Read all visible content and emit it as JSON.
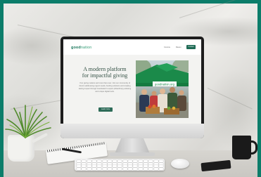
{
  "website": {
    "logo_part1": "good",
    "logo_part2": "nation",
    "nav_links": [
      "Commu",
      "Resou"
    ],
    "nav_button": "Contact",
    "hero_title_line1": "A modern platform",
    "hero_title_line2": "for impactful giving",
    "hero_body": "Your giving matters and more than ever. Join our community of donors addressing urgent needs, funding solutions and creating lasting impact through Goodnation's expert philanthropy advising and unique digital tools.",
    "hero_button": "Learn more",
    "photo_banner_text": "goodnation.org"
  },
  "colors": {
    "frame": "#0c7d6a",
    "brand_green": "#1f7a5f",
    "tent_green": "#1b8a4a"
  }
}
